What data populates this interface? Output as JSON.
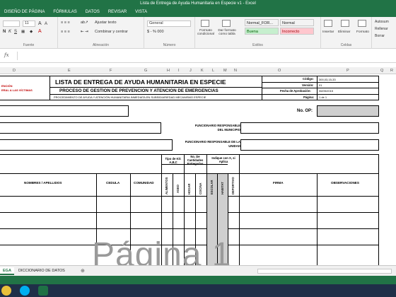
{
  "window": {
    "title": "Lista de Entrega de Ayuda Humanitaria en Especie v1 - Excel"
  },
  "menu": [
    "DISEÑO DE PÁGINA",
    "FÓRMULAS",
    "DATOS",
    "REVISAR",
    "VISTA"
  ],
  "ribbon": {
    "font_size": "11",
    "wrap_text": "Ajustar texto",
    "merge_center": "Combinar y centrar",
    "number_format": "General",
    "number_symbols": "$ - % 000",
    "conditional_format": "Formato condicional",
    "format_table": "Dar formato como tabla",
    "styles": [
      {
        "name": "Normal_FOR...",
        "bg": "#ffffff",
        "fg": "#222222"
      },
      {
        "name": "Normal",
        "bg": "#ffffff",
        "fg": "#222222"
      },
      {
        "name": "Buena",
        "bg": "#c6efce",
        "fg": "#006100"
      },
      {
        "name": "Incorrecto",
        "bg": "#ffc7ce",
        "fg": "#9c0006"
      }
    ],
    "insert": "Insertar",
    "delete": "Eliminar",
    "format": "Formato",
    "autosum": "Autosum",
    "fill": "Rellenar",
    "clear": "Borrar",
    "groups": [
      "Fuente",
      "Alineación",
      "Número",
      "Estilos",
      "Celdas"
    ]
  },
  "formula_bar": {
    "fx": "fx",
    "value": ""
  },
  "columns": [
    "D",
    "E",
    "F",
    "G",
    "H",
    "I",
    "J",
    "K",
    "L",
    "M",
    "N",
    "O",
    "P",
    "Q",
    "R"
  ],
  "sheet": {
    "org_line1": "ENCIÓN",
    "org_line2": "ERAL A LAS VÍCTIMAS",
    "title": "LISTA DE ENTREGA DE AYUDA HUMANITARIA EN ESPECIE",
    "subtitle": "PROCESO DE GESTION DE PREVENCION Y ATENCION DE EMERGENCIAS",
    "procedure": "PROCEDIMIENTO DE AYUDA Y ATENCIÓN HUMANITARIA INMEDIATA EN SUBSIDIARIEDAD MECANISMO ESPECIE",
    "codigo_label": "Código:",
    "codigo_value": "300,03,15-33",
    "version_label": "Versión:",
    "version_value": "01",
    "fecha_label": "Fecha de Aprobación:",
    "fecha_value": "06/05/2015",
    "pagina_label": "Página:",
    "pagina_value": "1 de 1",
    "no_op": "No. OP:",
    "func_municipio": "FUNCIONARIO RESPONSABLE DEL MUNICIPIO",
    "func_unidad": "FUNCIONARIO RESPONSABLE DE LA UNIDAD",
    "tipo_kit": "Tipo de Kit: A,B,C",
    "no_cantidades": "No. De Cantidades Entregadas",
    "indique": "Indique con X, si Aplica",
    "headers": {
      "nombres": "NOMBRES / APELLIDOS",
      "cedula": "CEDULA",
      "comunidad": "COMUNIDAD",
      "alimentos": "ALIMENTOS",
      "aseo": "ASEO",
      "hogar": "HOGAR",
      "cocina": "COCINA",
      "escolar": "ESCOLAR",
      "habitat": "HABITAT",
      "deportivo": "DEPORTIVO",
      "firma": "FIRMA",
      "observaciones": "OBSERVACIONES"
    },
    "watermark": "Página 1"
  },
  "sheet_tabs": [
    {
      "label": "EGA",
      "active": true
    },
    {
      "label": "DICCIONARIO DE DATOS",
      "active": false
    }
  ]
}
